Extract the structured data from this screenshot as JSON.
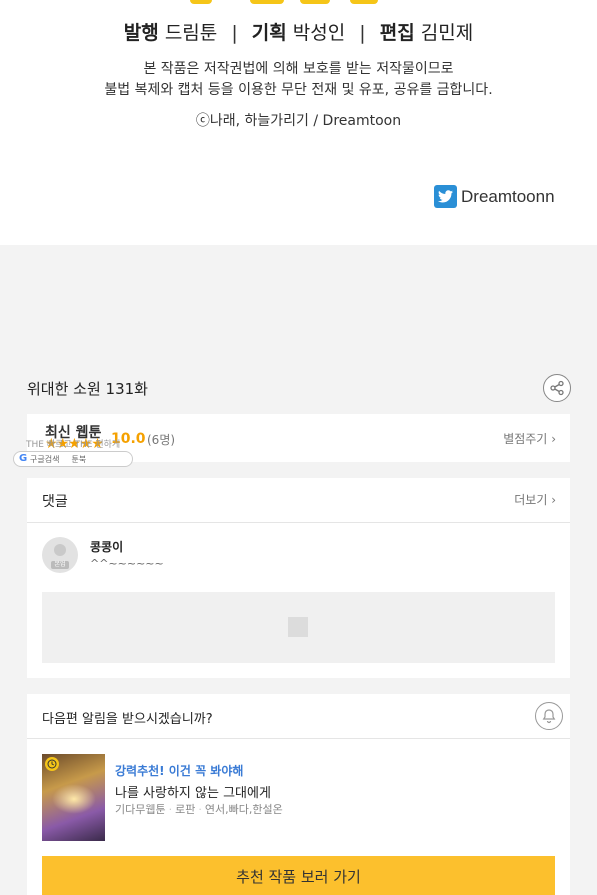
{
  "credits": {
    "publisher_label": "발행",
    "publisher_value": "드림툰",
    "planning_label": "기획",
    "planning_value": "박성인",
    "editing_label": "편집",
    "editing_value": "김민제",
    "separator": "|",
    "notice_line1": "본 작품은 저작권법에 의해 보호를 받는 저작물이므로",
    "notice_line2": "불법 복제와 캡처 등을 이용한 무단 전재 및 유포, 공유를 금합니다.",
    "copyright": "ⓒ나래, 하늘가리기 / Dreamtoon",
    "brand_name": "Dreamtoonn",
    "brand_icon": "twitter-bird-icon"
  },
  "episode": {
    "title": "위대한 소원 131화",
    "share_icon": "share-icon"
  },
  "rating": {
    "label": "최신 웹툰",
    "stars": "★★★★★",
    "score": "10.0",
    "count": "(6명)",
    "rate_link": "별점주기",
    "overlay_text_1": "THE 빠르고 THE 편하게",
    "google_bar_label": "구글검색",
    "google_bar_label2": "툰북"
  },
  "comments": {
    "title": "댓글",
    "more_link": "더보기",
    "items": [
      {
        "author": "콩콩이",
        "badge": "본업",
        "text": "^^~~~~~~"
      }
    ]
  },
  "next_episode": {
    "question": "다음편 알림을 받으시겠습니까?",
    "bell_icon": "bell-icon"
  },
  "recommendation": {
    "badge": "강력추천! 이건 꼭 봐야해",
    "title": "나를 사랑하지 않는 그대에게",
    "meta": [
      "기다무웹툰",
      "로판",
      "연서,빠다,한설온"
    ],
    "button_label": "추천 작품 보러 가기"
  },
  "colors": {
    "accent_yellow": "#fcc02d",
    "star_orange": "#f5a100",
    "link_blue": "#3a7bd5",
    "brand_blue": "#2a8fd6"
  }
}
